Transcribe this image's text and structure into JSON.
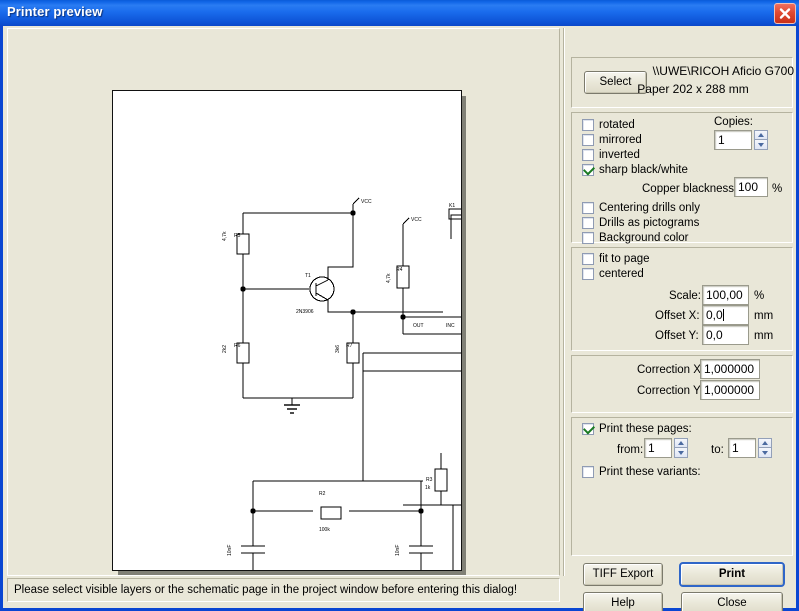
{
  "window": {
    "title": "Printer preview",
    "close_icon": "close-icon"
  },
  "printer": {
    "select_button": "Select",
    "name": "\\\\UWE\\RICOH Aficio G700",
    "paper": "Paper 202 x 288 mm"
  },
  "options": {
    "rotated": {
      "label": "rotated",
      "checked": false
    },
    "mirrored": {
      "label": "mirrored",
      "checked": false
    },
    "inverted": {
      "label": "inverted",
      "checked": false
    },
    "sharp_bw": {
      "label": "sharp black/white",
      "checked": true
    },
    "copies_label": "Copies:",
    "copies_value": "1",
    "copper_blackness_label": "Copper blackness:",
    "copper_blackness_value": "100",
    "copper_blackness_unit": "%",
    "centering_drills": {
      "label": "Centering drills only",
      "checked": false
    },
    "drills_pictograms": {
      "label": "Drills as pictograms",
      "checked": false
    },
    "background_color": {
      "label": "Background color",
      "checked": false
    }
  },
  "scale": {
    "fit_to_page": {
      "label": "fit to page",
      "checked": false
    },
    "centered": {
      "label": "centered",
      "checked": false
    },
    "scale_label": "Scale:",
    "scale_value": "100,00",
    "scale_unit": "%",
    "offset_x_label": "Offset X:",
    "offset_x_value": "0,0",
    "offset_x_unit": "mm",
    "offset_y_label": "Offset Y:",
    "offset_y_value": "0,0",
    "offset_y_unit": "mm"
  },
  "correction": {
    "x_label": "Correction X:",
    "x_value": "1,000000",
    "y_label": "Correction Y:",
    "y_value": "1,000000"
  },
  "pages": {
    "print_pages": {
      "label": "Print these pages:",
      "checked": true
    },
    "from_label": "from:",
    "from_value": "1",
    "to_label": "to:",
    "to_value": "1",
    "print_variants": {
      "label": "Print these variants:",
      "checked": false
    }
  },
  "buttons": {
    "tiff_export": "TIFF Export",
    "print": "Print",
    "help": "Help",
    "close": "Close"
  },
  "status": {
    "message": "Please select visible layers or the schematic page in the project window before entering this dialog!"
  },
  "colors": {
    "titlebar_blue": "#1267e8",
    "dialog_face": "#e9e7d8",
    "paper_white": "#ffffff",
    "paper_shadow": "#808076",
    "default_button_border": "#2f66c8",
    "check_green": "#1a7a22",
    "close_red": "#c93018"
  }
}
